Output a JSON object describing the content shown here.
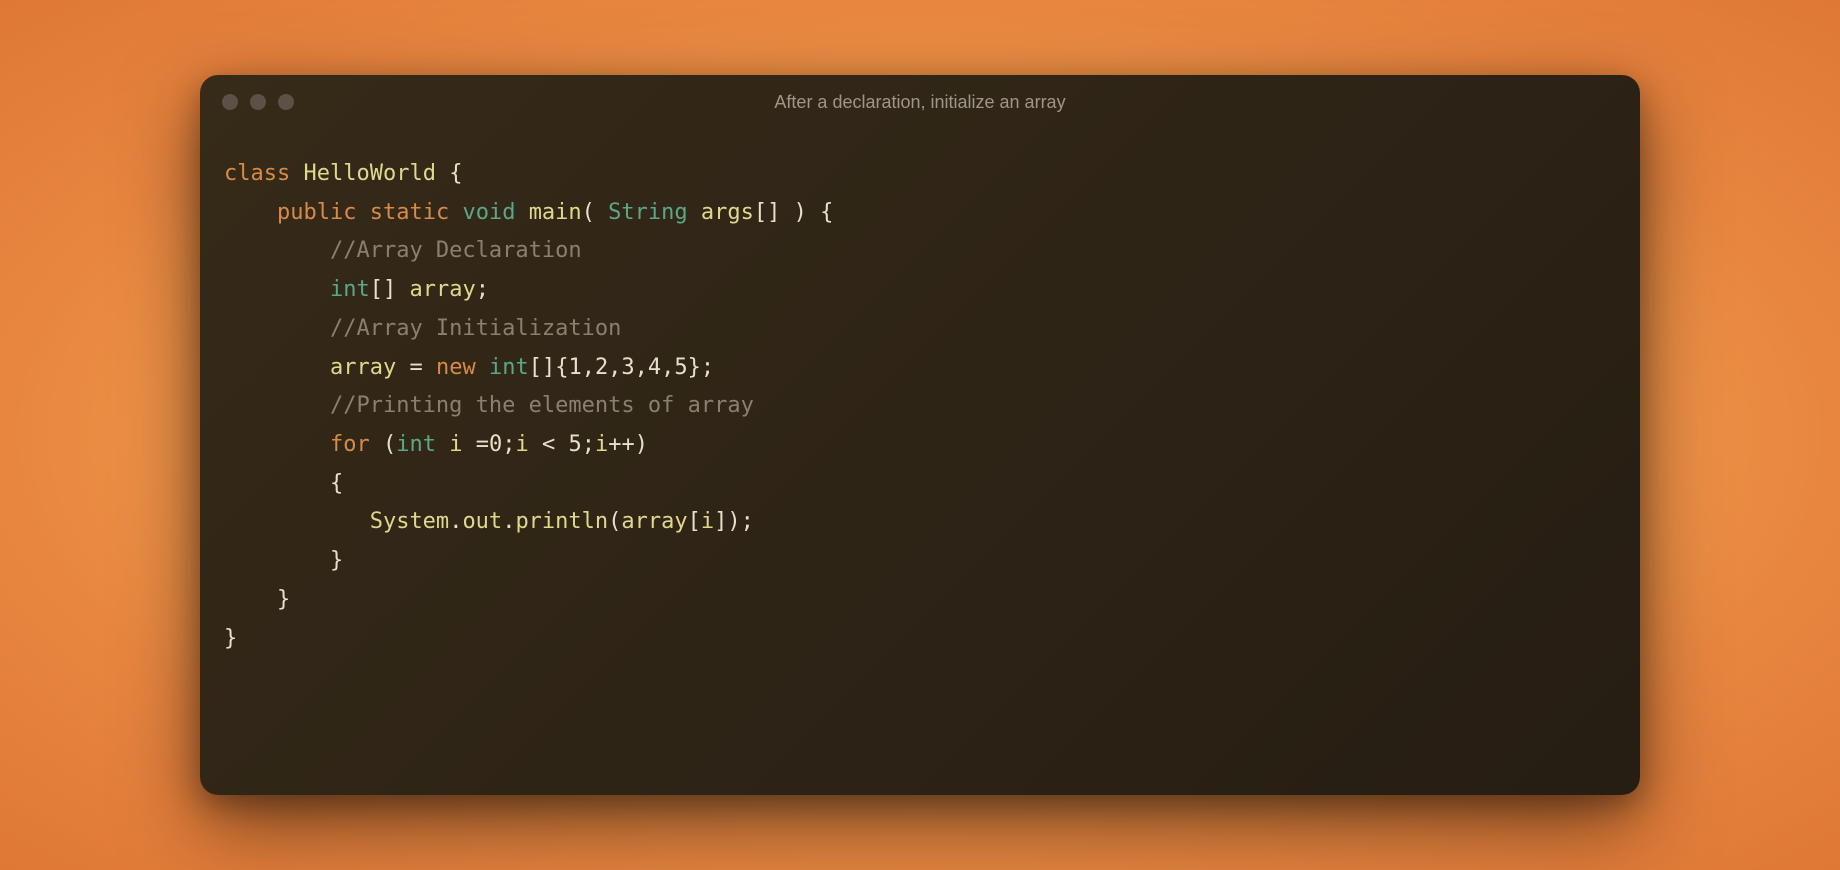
{
  "window": {
    "title": "After a declaration, initialize an array"
  },
  "tokens": {
    "class_kw": "class",
    "class_name": "HelloWorld",
    "open_brace": "{",
    "public_kw": "public",
    "static_kw": "static",
    "void_kw": "void",
    "main_name": "main",
    "paren_open": "(",
    "string_type": "String",
    "args_name": "args",
    "brackets": "[]",
    "paren_close": ")",
    "comment_decl": "//Array Declaration",
    "int_kw": "int",
    "array_name": "array",
    "semicolon": ";",
    "comment_init": "//Array Initialization",
    "equals": "=",
    "new_kw": "new",
    "array_literal": "{1,2,3,4,5}",
    "comment_print": "//Printing the elements of array",
    "for_kw": "for",
    "i_name": "i",
    "zero": "0",
    "lt": "<",
    "five": "5",
    "inc": "++",
    "system": "System",
    "dot": ".",
    "out": "out",
    "println": "println",
    "bracket_open": "[",
    "bracket_close": "]",
    "close_brace": "}"
  }
}
